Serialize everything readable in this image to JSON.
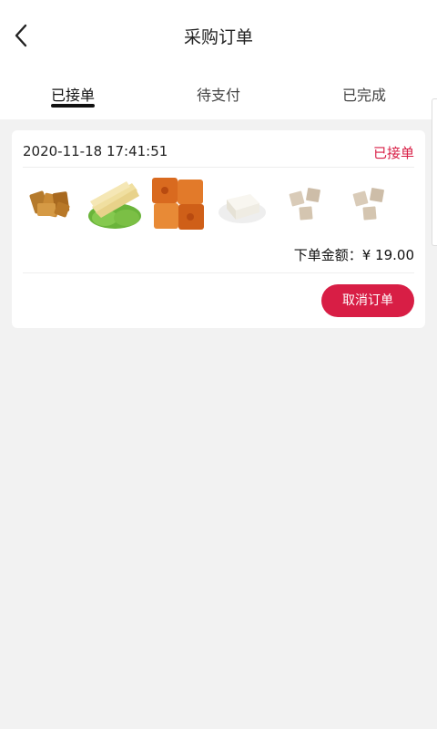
{
  "header": {
    "title": "采购订单",
    "back_icon": "chevron-left-icon"
  },
  "tabs": [
    {
      "label": "已接单",
      "active": true
    },
    {
      "label": "待支付",
      "active": false
    },
    {
      "label": "已完成",
      "active": false
    }
  ],
  "order": {
    "time": "2020-11-18 17:41:51",
    "status": "已接单",
    "status_color": "#d81e45",
    "products": [
      {
        "name": "fried-tofu-strips-image"
      },
      {
        "name": "tofu-skin-on-lettuce-image"
      },
      {
        "name": "fried-tofu-squares-image"
      },
      {
        "name": "silken-tofu-image"
      },
      {
        "name": "dried-tofu-blocks-image"
      },
      {
        "name": "dried-tofu-blocks-image"
      }
    ],
    "total_label": "下单金额：",
    "total_value": "¥ 19.00",
    "cancel_label": "取消订单"
  },
  "colors": {
    "accent": "#d81e45",
    "background": "#f2f2f2",
    "card": "#ffffff"
  }
}
